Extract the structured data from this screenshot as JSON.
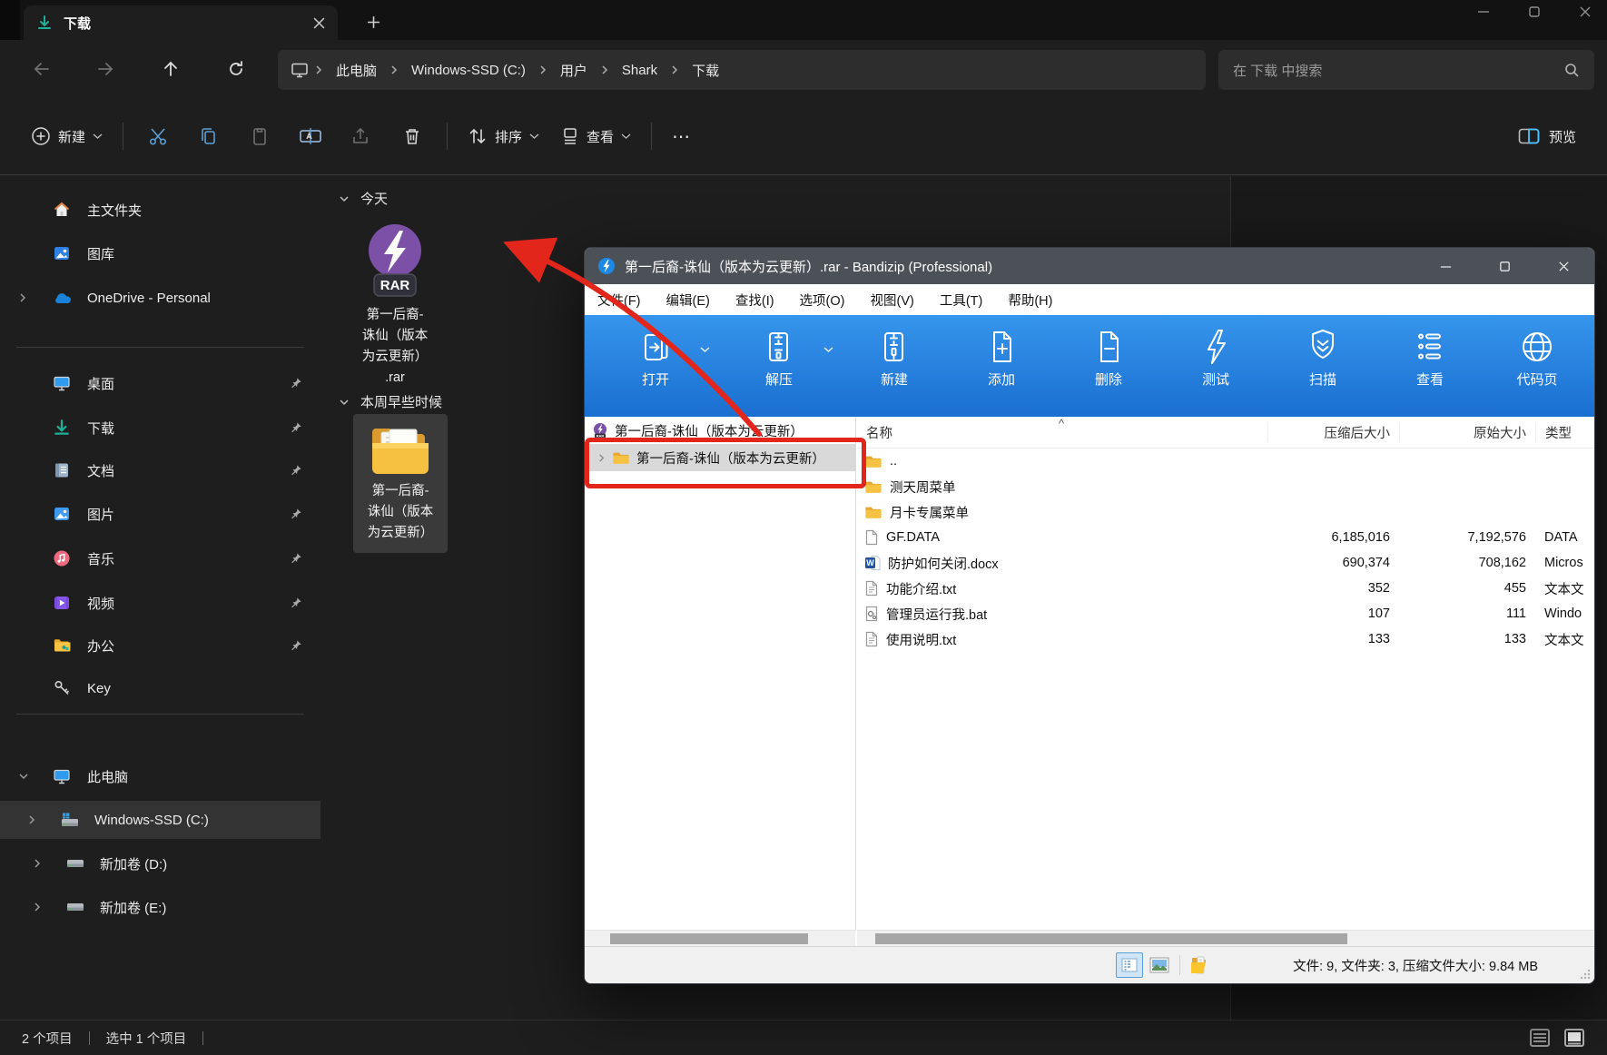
{
  "colors": {
    "accent_blue": "#1a6fd0",
    "bandizip_titlebar": "#4b5157",
    "annotation_red": "#e3261c",
    "folder_yellow": "#f5bc3e",
    "rar_purple": "#7c50a6",
    "explorer_bg": "#1e1e1e"
  },
  "explorer": {
    "tab_title": "下载",
    "breadcrumb": [
      "此电脑",
      "Windows-SSD (C:)",
      "用户",
      "Shark",
      "下载"
    ],
    "search_placeholder": "在 下载 中搜索",
    "commands": {
      "new": "新建",
      "sort": "排序",
      "view": "查看",
      "more": "⋯",
      "preview": "预览"
    },
    "sidebar": {
      "quick": [
        {
          "label": "主文件夹"
        },
        {
          "label": "图库"
        },
        {
          "label": "OneDrive - Personal"
        }
      ],
      "pinned": [
        {
          "label": "桌面"
        },
        {
          "label": "下载"
        },
        {
          "label": "文档"
        },
        {
          "label": "图片"
        },
        {
          "label": "音乐"
        },
        {
          "label": "视频"
        },
        {
          "label": "办公"
        },
        {
          "label": "Key"
        }
      ],
      "this_pc": "此电脑",
      "drives": [
        {
          "label": "Windows-SSD (C:)"
        },
        {
          "label": "新加卷 (D:)"
        },
        {
          "label": "新加卷 (E:)"
        }
      ]
    },
    "groups": {
      "today": "今天",
      "earlier": "本周早些时候"
    },
    "rar_file": {
      "line1": "第一后裔-",
      "line2": "诛仙（版本",
      "line3": "为云更新）",
      "line4": ".rar",
      "badge": "RAR"
    },
    "folder_item": {
      "line1": "第一后裔-",
      "line2": "诛仙（版本",
      "line3": "为云更新）"
    },
    "status": {
      "count": "2 个项目",
      "selection": "选中 1 个项目"
    }
  },
  "bandizip": {
    "title": "第一后裔-诛仙（版本为云更新）.rar - Bandizip (Professional)",
    "menu": [
      {
        "label": "文件(F)"
      },
      {
        "label": "编辑(E)"
      },
      {
        "label": "查找(I)"
      },
      {
        "label": "选项(O)"
      },
      {
        "label": "视图(V)"
      },
      {
        "label": "工具(T)"
      },
      {
        "label": "帮助(H)"
      }
    ],
    "toolbar": [
      {
        "label": "打开"
      },
      {
        "label": "解压"
      },
      {
        "label": "新建"
      },
      {
        "label": "添加"
      },
      {
        "label": "删除"
      },
      {
        "label": "测试"
      },
      {
        "label": "扫描"
      },
      {
        "label": "查看"
      },
      {
        "label": "代码页"
      }
    ],
    "tree": {
      "root": "第一后裔-诛仙（版本为云更新）",
      "child": "第一后裔-诛仙（版本为云更新）"
    },
    "columns": {
      "name": "名称",
      "packed": "压缩后大小",
      "original": "原始大小",
      "type": "类型"
    },
    "sort_indicator": "^",
    "rows": [
      {
        "name": "..",
        "packed": "",
        "original": "",
        "type": ""
      },
      {
        "name": "测天周菜单",
        "packed": "",
        "original": "",
        "type": ""
      },
      {
        "name": "月卡专属菜单",
        "packed": "",
        "original": "",
        "type": ""
      },
      {
        "name": "GF.DATA",
        "packed": "6,185,016",
        "original": "7,192,576",
        "type": "DATA"
      },
      {
        "name": "防护如何关闭.docx",
        "packed": "690,374",
        "original": "708,162",
        "type": "Micros"
      },
      {
        "name": "功能介绍.txt",
        "packed": "352",
        "original": "455",
        "type": "文本文"
      },
      {
        "name": "管理员运行我.bat",
        "packed": "107",
        "original": "111",
        "type": "Windo"
      },
      {
        "name": "使用说明.txt",
        "packed": "133",
        "original": "133",
        "type": "文本文"
      }
    ],
    "status": "文件: 9, 文件夹: 3, 压缩文件大小: 9.84 MB"
  }
}
